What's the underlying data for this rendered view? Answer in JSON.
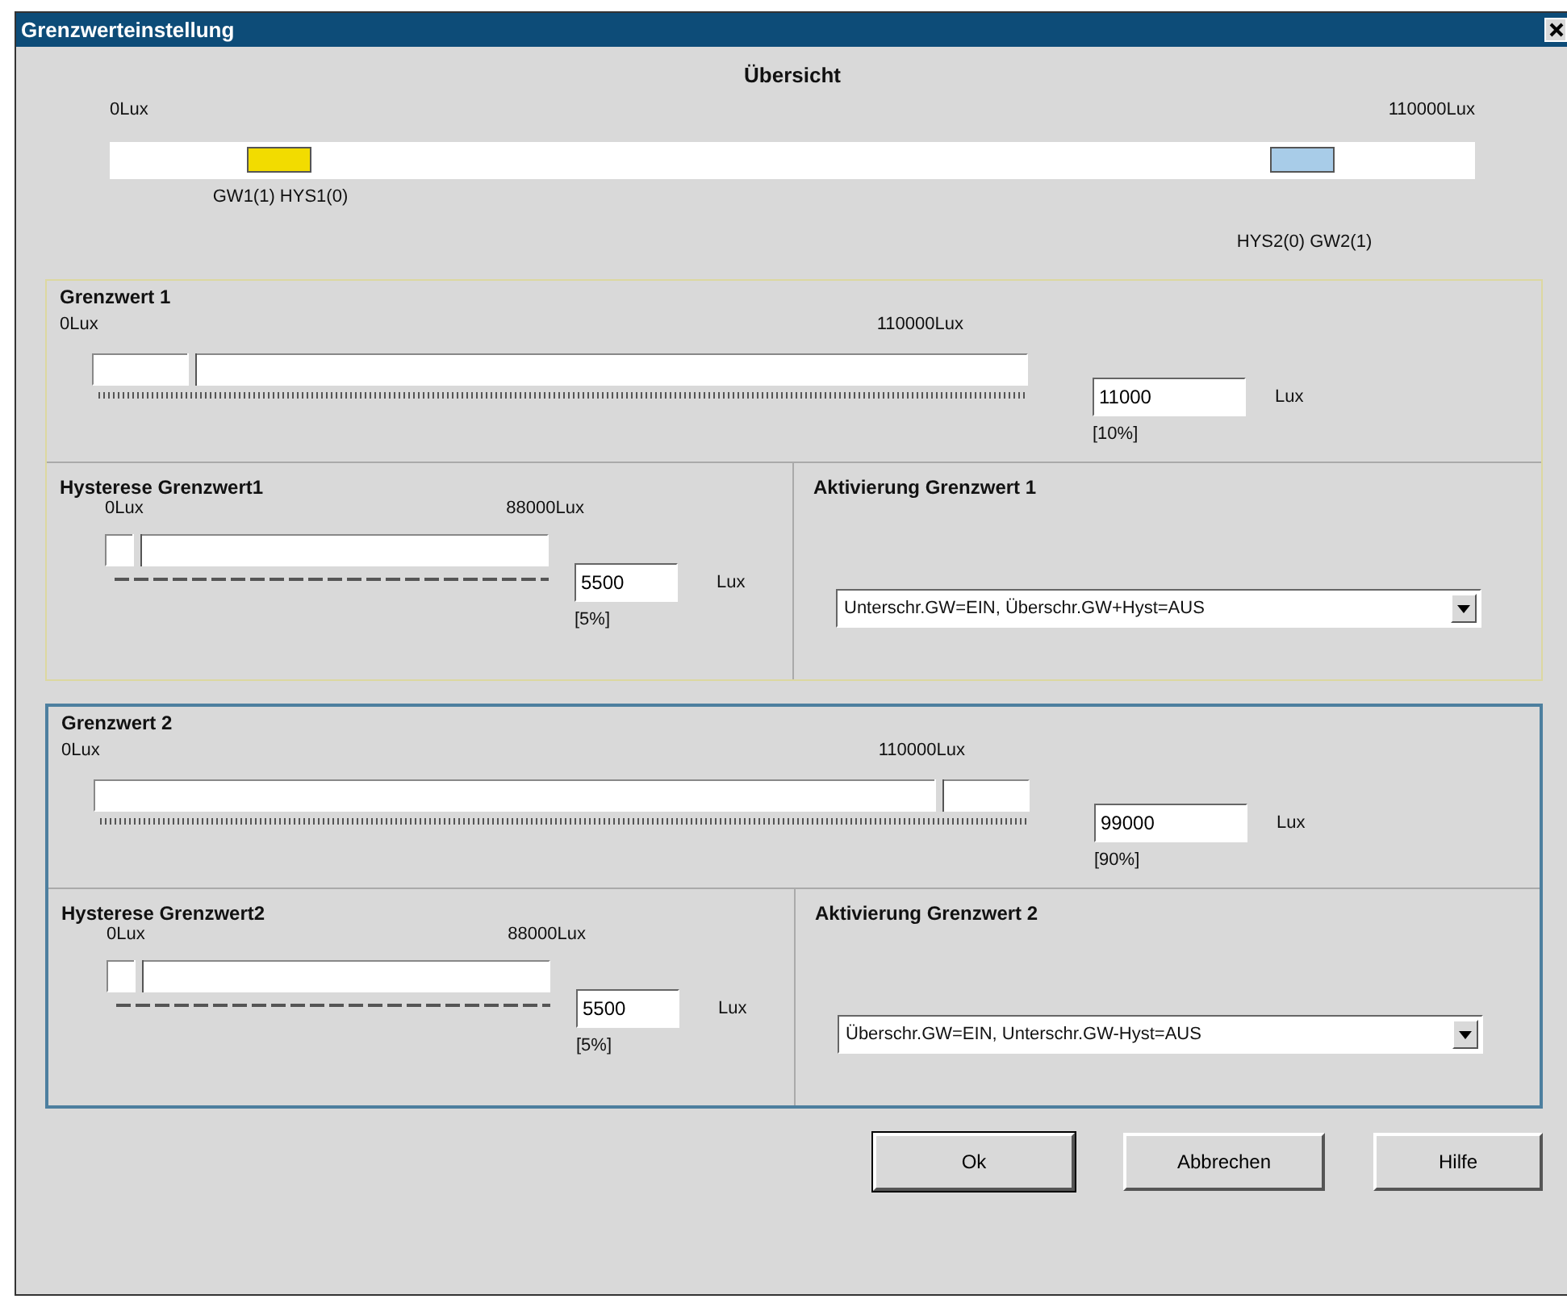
{
  "window": {
    "title": "Grenzwerteinstellung"
  },
  "overview": {
    "title": "Übersicht",
    "min_label": "0Lux",
    "max_label": "110000Lux",
    "markers": [
      {
        "label": "GW1(1) HYS1(0)",
        "level": 0.125,
        "color": "#f2dc00"
      },
      {
        "label": "HYS2(0) GW2(1)",
        "level": 0.875,
        "color": "#a8cce8"
      }
    ]
  },
  "groups": [
    {
      "title": "Grenzwert 1",
      "color": "#dcd8a0",
      "threshold": {
        "min_label": "0Lux",
        "max_label": "110000Lux",
        "level": 0.1,
        "value": "11000",
        "unit": "Lux",
        "percent": "[10%]"
      },
      "hysteresis": {
        "title": "Hysterese Grenzwert1",
        "min_label": "0Lux",
        "max_label": "88000Lux",
        "level": 0.06,
        "value": "5500",
        "unit": "Lux",
        "percent": "[5%]"
      },
      "activation": {
        "title": "Aktivierung Grenzwert 1",
        "value": "Unterschr.GW=EIN, Überschr.GW+Hyst=AUS"
      }
    },
    {
      "title": "Grenzwert 2",
      "color": "#4d7f9f",
      "threshold": {
        "min_label": "0Lux",
        "max_label": "110000Lux",
        "level": 0.9,
        "value": "99000",
        "unit": "Lux",
        "percent": "[90%]"
      },
      "hysteresis": {
        "title": "Hysterese Grenzwert2",
        "min_label": "0Lux",
        "max_label": "88000Lux",
        "level": 0.06,
        "value": "5500",
        "unit": "Lux",
        "percent": "[5%]"
      },
      "activation": {
        "title": "Aktivierung Grenzwert 2",
        "value": "Überschr.GW=EIN, Unterschr.GW-Hyst=AUS"
      }
    }
  ],
  "buttons": [
    {
      "label": "Ok",
      "default": true
    },
    {
      "label": "Abbrechen",
      "default": false
    },
    {
      "label": "Hilfe",
      "default": false
    }
  ]
}
